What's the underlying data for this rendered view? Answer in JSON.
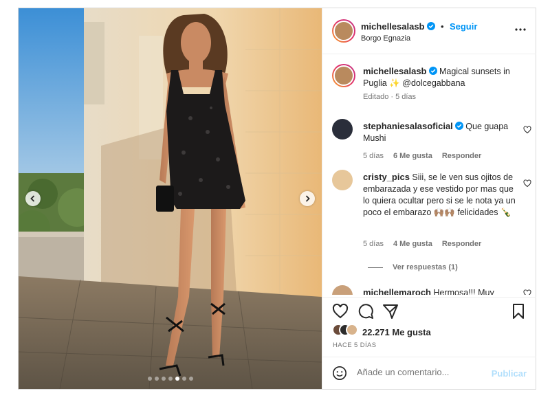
{
  "header": {
    "username": "michellesalasb",
    "follow_label": "Seguir",
    "separator": "•",
    "location": "Borgo Egnazia",
    "more_icon": "more-horizontal-icon"
  },
  "caption": {
    "username": "michellesalasb",
    "text": "Magical sunsets in Puglia ✨ @dolcegabbana",
    "meta": "Editado · 5 días"
  },
  "comments": [
    {
      "username": "stephaniesalasoficial",
      "verified": true,
      "text": "Que guapa Mushi",
      "age": "5 días",
      "likes": "6 Me gusta",
      "reply": "Responder"
    },
    {
      "username": "cristy_pics",
      "verified": false,
      "text": "Siii, se le ven sus ojitos de embarazada y ese vestido por mas que lo quiera ocultar pero si se le nota ya un poco el embarazo 🙌🏽🙌🏽 felicidades 🍾",
      "age": "5 días",
      "likes": "4 Me gusta",
      "reply": "Responder",
      "view_replies": "Ver respuestas (1)"
    },
    {
      "username": "michellemaroch",
      "verified": false,
      "text": "Hermosa!!! Muy"
    }
  ],
  "actions": {
    "like_icon": "heart-icon",
    "comment_icon": "comment-icon",
    "share_icon": "send-icon",
    "save_icon": "bookmark-icon"
  },
  "likes_text": "22.271 Me gusta",
  "posted_ago": "HACE 5 DÍAS",
  "composer": {
    "placeholder": "Añade un comentario...",
    "post_label": "Publicar",
    "emoji_icon": "emoji-icon"
  },
  "carousel": {
    "total": 7,
    "active_index": 4
  },
  "colors": {
    "accent": "#0095f6",
    "text": "#262626",
    "muted": "#737373",
    "border": "#dbdbdb"
  }
}
